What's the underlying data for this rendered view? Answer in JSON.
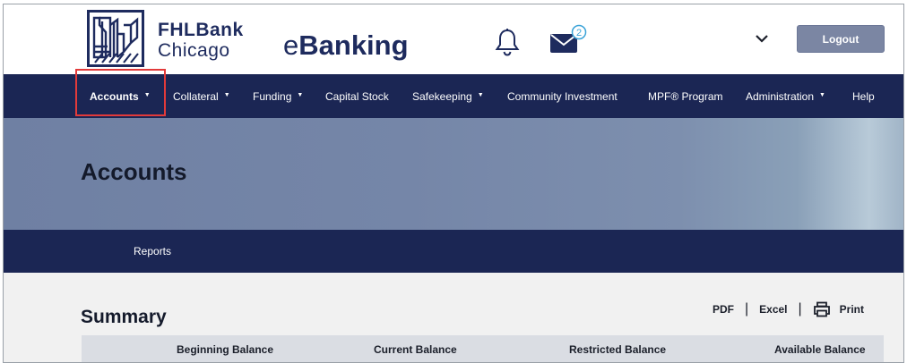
{
  "brand": {
    "name_line1": "FHLBank",
    "name_line2": "Chicago",
    "product_prefix": "e",
    "product_suffix": "Banking"
  },
  "header": {
    "notifications_icon": "bell-icon",
    "messages_icon": "mail-icon",
    "messages_count": "2",
    "user_menu_icon": "chevron-down-icon",
    "logout_label": "Logout"
  },
  "nav": {
    "items": [
      {
        "label": "Accounts",
        "has_dropdown": true,
        "active": true
      },
      {
        "label": "Collateral",
        "has_dropdown": true
      },
      {
        "label": "Funding",
        "has_dropdown": true
      },
      {
        "label": "Capital Stock",
        "has_dropdown": false
      },
      {
        "label": "Safekeeping",
        "has_dropdown": true
      },
      {
        "label": "Community Investment",
        "has_dropdown": false
      },
      {
        "label": "MPF® Program",
        "has_dropdown": false
      },
      {
        "label": "Administration",
        "has_dropdown": true
      },
      {
        "label": "Help",
        "has_dropdown": false
      }
    ],
    "caret": "▼"
  },
  "banner": {
    "title": "Accounts"
  },
  "subnav": {
    "items": [
      {
        "label": "Reports"
      }
    ]
  },
  "summary": {
    "title": "Summary",
    "export": {
      "pdf_label": "PDF",
      "excel_label": "Excel",
      "print_label": "Print",
      "separator": "|"
    },
    "columns": [
      "Beginning Balance",
      "Current Balance",
      "Restricted Balance",
      "Available Balance"
    ]
  },
  "colors": {
    "navy": "#1b2654",
    "brand": "#1e2b5e",
    "highlight": "#e23a3a",
    "logout_bg": "#7b86a3"
  }
}
